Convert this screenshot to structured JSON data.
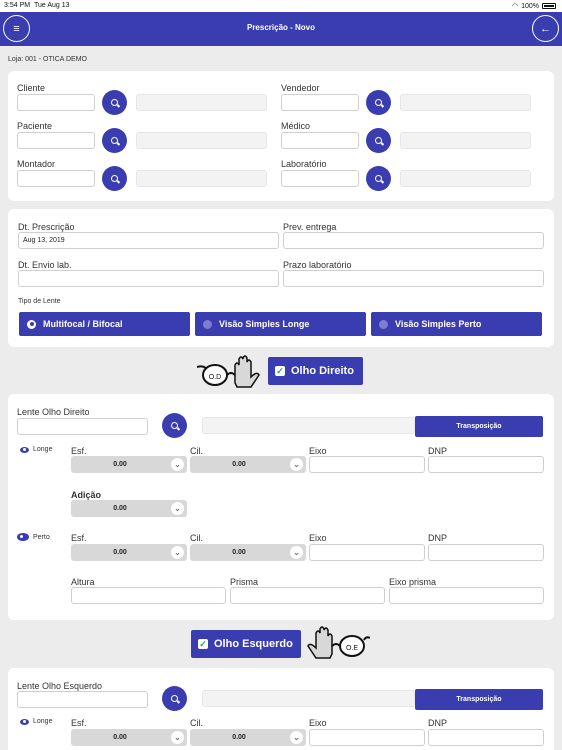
{
  "status": {
    "time": "3:54 PM",
    "date": "Tue Aug 13",
    "battery": "100%"
  },
  "nav": {
    "title": "Prescrição - Novo"
  },
  "loja": "Loja: 001 - OTICA DEMO",
  "cliente": {
    "cliente": "Cliente",
    "paciente": "Paciente",
    "montador": "Montador",
    "vendedor": "Vendedor",
    "medico": "Médico",
    "laboratorio": "Laboratório"
  },
  "datas": {
    "dt_prescricao": "Dt. Prescrição",
    "dt_prescricao_value": "Aug 13, 2019",
    "prev_entrega": "Prev. entrega",
    "dt_envio": "Dt. Envio lab.",
    "prazo": "Prazo laboratório",
    "tipo_lente": "Tipo de Lente",
    "tipos": [
      "Multifocal / Bifocal",
      "Visão Simples Longe",
      "Visão Simples Perto"
    ],
    "tipo_selected": 0
  },
  "od": {
    "toggle": "Olho Direito",
    "glasses_tag": "O.D",
    "lente": "Lente Olho Direito",
    "transposicao": "Transposição",
    "longe": "Longe",
    "perto": "Perto",
    "esf": "Esf.",
    "cil": "Cil.",
    "eixo": "Eixo",
    "dnp": "DNP",
    "adicao": "Adição",
    "longe_esf": "0.00",
    "longe_cil": "0.00",
    "adicao_value": "0.00",
    "perto_esf": "0.00",
    "perto_cil": "0.00",
    "altura": "Altura",
    "prisma": "Prisma",
    "eixo_prisma": "Eixo prisma"
  },
  "oe": {
    "toggle": "Olho Esquerdo",
    "glasses_tag": "O.E",
    "lente": "Lente Olho Esquerdo",
    "transposicao": "Transposição",
    "longe": "Longe",
    "esf": "Esf.",
    "cil": "Cil.",
    "eixo": "Eixo",
    "dnp": "DNP",
    "longe_esf": "0.00",
    "longe_cil": "0.00"
  },
  "colors": {
    "primary": "#3a3db0",
    "background": "#ececec",
    "check": "#2aa84a"
  }
}
